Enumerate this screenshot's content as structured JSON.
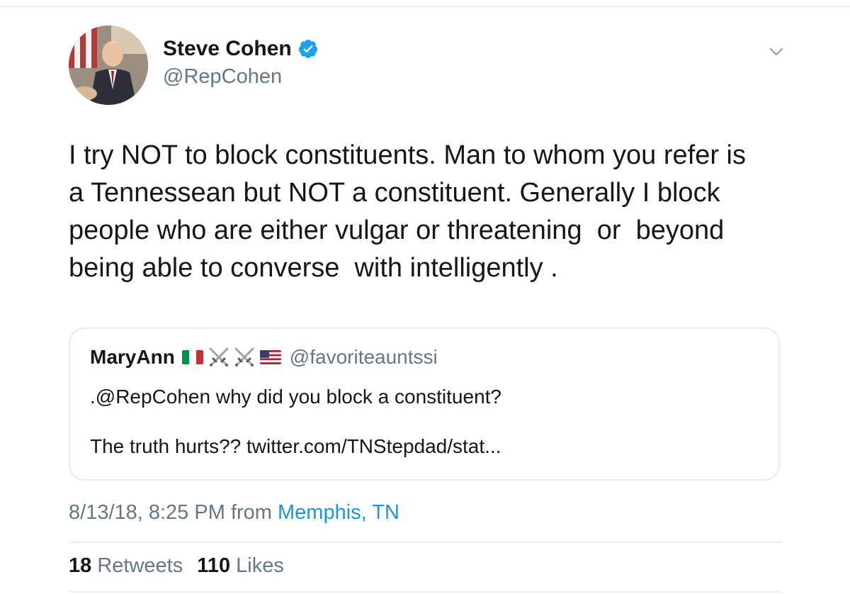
{
  "author": {
    "display_name": "Steve Cohen",
    "handle": "@RepCohen",
    "avatar_icon": "profile-photo",
    "verified_icon": "verified-badge-icon",
    "verified_color": "#1da1f2"
  },
  "tweet": {
    "text": "I try NOT to block constituents. Man to whom you refer is\na Tennessean but NOT a constituent. Generally I block\npeople who are either vulgar or threatening  or  beyond\nbeing able to converse  with intelligently ."
  },
  "quote": {
    "name": "MaryAnn",
    "emoji_icons": [
      "italy-flag-icon",
      "crossed-swords-icon",
      "crossed-swords-icon",
      "us-flag-icon"
    ],
    "handle": "@favoriteauntssi",
    "line1": ".@RepCohen why did you block a constituent?",
    "line2": "The truth hurts?? twitter.com/TNStepdad/stat..."
  },
  "meta": {
    "timestamp": "8/13/18, 8:25 PM",
    "from_label": "from",
    "location": "Memphis, TN"
  },
  "stats": {
    "retweets_count": "18",
    "retweets_label": "Retweets",
    "likes_count": "110",
    "likes_label": "Likes"
  },
  "colors": {
    "link": "#1b95e0",
    "secondary_text": "#657786",
    "divider": "#e6ecf0"
  }
}
